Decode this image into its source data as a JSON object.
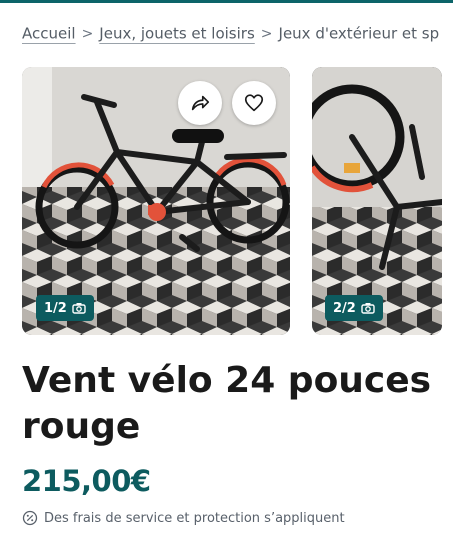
{
  "breadcrumb": {
    "items": [
      {
        "label": "Accueil"
      },
      {
        "label": "Jeux, jouets et loisirs"
      },
      {
        "label": "Jeux d'extérieur et sp"
      }
    ],
    "separator": ">"
  },
  "gallery": {
    "photos": [
      {
        "counter": "1/2"
      },
      {
        "counter": "2/2"
      }
    ]
  },
  "listing": {
    "title": "Vent vélo 24 pouces rouge",
    "price": "215,00€",
    "fees_notice": "Des frais de service et protection s’appliquent"
  },
  "icons": {
    "share": "share-icon",
    "favorite": "heart-icon",
    "camera": "camera-icon",
    "percent": "percent-badge-icon"
  },
  "colors": {
    "accent": "#0d5b5f",
    "top_bar": "#0c6469",
    "text": "#1a1a1a",
    "muted_text": "#59616b"
  }
}
